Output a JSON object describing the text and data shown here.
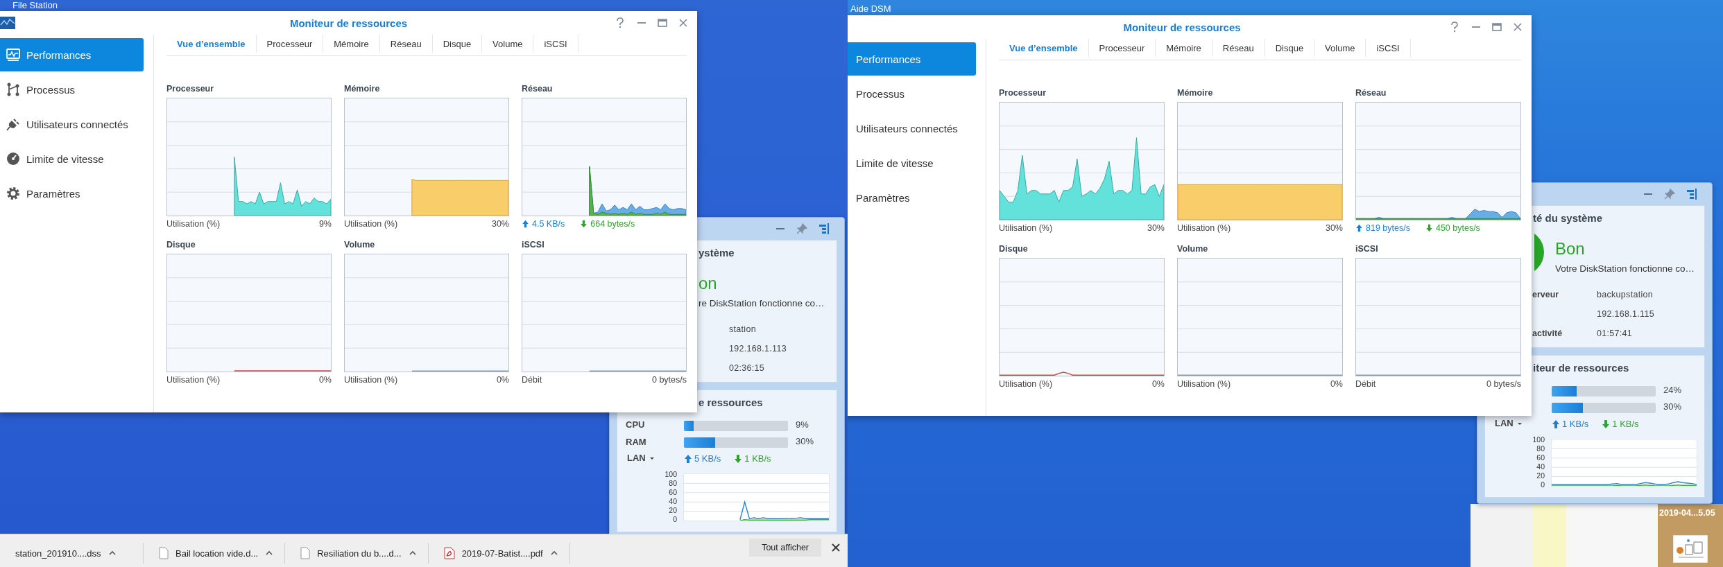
{
  "screens": [
    {
      "top_label": "File Station",
      "window": {
        "title": "Moniteur de ressources",
        "sidebar": [
          {
            "label": "Performances",
            "selected": true
          },
          {
            "label": "Processus",
            "selected": false
          },
          {
            "label": "Utilisateurs connectés",
            "selected": false
          },
          {
            "label": "Limite de vitesse",
            "selected": false
          },
          {
            "label": "Paramètres",
            "selected": false
          }
        ],
        "tabs": [
          {
            "label": "Vue d’ensemble",
            "selected": true
          },
          {
            "label": "Processeur",
            "selected": false
          },
          {
            "label": "Mémoire",
            "selected": false
          },
          {
            "label": "Réseau",
            "selected": false
          },
          {
            "label": "Disque",
            "selected": false
          },
          {
            "label": "Volume",
            "selected": false
          },
          {
            "label": "iSCSI",
            "selected": false
          }
        ],
        "panels": [
          {
            "kind": "usage",
            "title": "Processeur",
            "caption": "Utilisation (%)",
            "value": "9%"
          },
          {
            "kind": "usage",
            "title": "Mémoire",
            "caption": "Utilisation (%)",
            "value": "30%"
          },
          {
            "kind": "network",
            "title": "Réseau",
            "upload": "4.5 KB/s",
            "download": "664 bytes/s"
          },
          {
            "kind": "usage",
            "title": "Disque",
            "caption": "Utilisation (%)",
            "value": "0%"
          },
          {
            "kind": "usage",
            "title": "Volume",
            "caption": "Utilisation (%)",
            "value": "0%"
          },
          {
            "kind": "usage",
            "title": "iSCSI",
            "caption": "Débit",
            "value": "0 bytes/s"
          }
        ]
      },
      "widget": {
        "health": {
          "title": "ystème",
          "status": "on",
          "message": "re DiskStation fonctionne co…",
          "rows": [
            {
              "value": "station"
            },
            {
              "value": "192.168.1.113"
            },
            {
              "value": "02:36:15"
            }
          ]
        },
        "monitor": {
          "title": "e ressources",
          "meters": [
            {
              "label": "CPU",
              "level": 0.09,
              "reading": "9%"
            },
            {
              "label": "RAM",
              "level": 0.3,
              "reading": "30%"
            }
          ],
          "network": {
            "label": "LAN",
            "upload": "5 KB/s",
            "download": "1 KB/s"
          },
          "chart_data": {
            "type": "line",
            "grid": true,
            "ylim": [
              0,
              100
            ],
            "yticks": [
              0,
              20,
              40,
              60,
              80,
              100
            ],
            "series": [
              {
                "color": "#2a86c8",
                "values": [
                  null,
                  null,
                  null,
                  null,
                  null,
                  null,
                  null,
                  null,
                  null,
                  null,
                  null,
                  null,
                  2,
                  40,
                  4,
                  6,
                  4,
                  6,
                  4,
                  4,
                  4,
                  4,
                  5,
                  4,
                  5,
                  6,
                  4,
                  4,
                  4,
                  4,
                  4,
                  4
                ]
              },
              {
                "color": "#3fae3f",
                "values": [
                  null,
                  null,
                  null,
                  null,
                  null,
                  null,
                  null,
                  null,
                  null,
                  null,
                  null,
                  null,
                  0,
                  2,
                  1,
                  1,
                  1,
                  1,
                  1,
                  1,
                  1,
                  1,
                  1,
                  1,
                  1,
                  1,
                  1,
                  2,
                  2,
                  2,
                  2,
                  2
                ]
              }
            ]
          }
        }
      },
      "downloads": {
        "items": [
          {
            "kind": "file",
            "name": "station_201910....dss"
          },
          {
            "kind": "document",
            "name": "Bail location vide.d..."
          },
          {
            "kind": "document",
            "name": "Resiliation du b....d..."
          },
          {
            "kind": "pdf",
            "name": "2019-07-Batist....pdf"
          }
        ],
        "show_all": "Tout afficher"
      }
    },
    {
      "top_label": "Aide DSM",
      "window": {
        "title": "Moniteur de ressources",
        "sidebar": [
          {
            "label": "Performances",
            "selected": true
          },
          {
            "label": "Processus",
            "selected": false
          },
          {
            "label": "Utilisateurs connectés",
            "selected": false
          },
          {
            "label": "Limite de vitesse",
            "selected": false
          },
          {
            "label": "Paramètres",
            "selected": false
          }
        ],
        "tabs": [
          {
            "label": "Vue d’ensemble",
            "selected": true
          },
          {
            "label": "Processeur",
            "selected": false
          },
          {
            "label": "Mémoire",
            "selected": false
          },
          {
            "label": "Réseau",
            "selected": false
          },
          {
            "label": "Disque",
            "selected": false
          },
          {
            "label": "Volume",
            "selected": false
          },
          {
            "label": "iSCSI",
            "selected": false
          }
        ],
        "panels": [
          {
            "kind": "usage",
            "title": "Processeur",
            "caption": "Utilisation (%)",
            "value": "30%"
          },
          {
            "kind": "usage",
            "title": "Mémoire",
            "caption": "Utilisation (%)",
            "value": "30%"
          },
          {
            "kind": "network",
            "title": "Réseau",
            "upload": "819 bytes/s",
            "download": "450 bytes/s"
          },
          {
            "kind": "usage",
            "title": "Disque",
            "caption": "Utilisation (%)",
            "value": "0%"
          },
          {
            "kind": "usage",
            "title": "Volume",
            "caption": "Utilisation (%)",
            "value": "0%"
          },
          {
            "kind": "usage",
            "title": "iSCSI",
            "caption": "Débit",
            "value": "0 bytes/s"
          }
        ]
      },
      "widget": {
        "health": {
          "title": "té du système",
          "status": "Bon",
          "status_icon": true,
          "message": "Votre DiskStation fonctionne co…",
          "rows": [
            {
              "label": "erveur",
              "value": "backupstation"
            },
            {
              "value": "192.168.1.115"
            },
            {
              "label": "activité",
              "value": "01:57:41"
            }
          ]
        },
        "monitor": {
          "title": "iteur de ressources",
          "meters": [
            {
              "level": 0.24,
              "reading": "24%"
            },
            {
              "level": 0.3,
              "reading": "30%"
            }
          ],
          "network": {
            "label": "LAN",
            "upload": "1 KB/s",
            "download": "1 KB/s"
          },
          "chart_data": {
            "type": "line",
            "grid": true,
            "ylim": [
              0,
              100
            ],
            "yticks": [
              0,
              20,
              40,
              60,
              80,
              100
            ],
            "series": [
              {
                "color": "#2a86c8",
                "values": [
                  3,
                  3,
                  3,
                  3,
                  3,
                  3,
                  3,
                  3,
                  3,
                  3,
                  3,
                  3,
                  3,
                  4,
                  5,
                  3,
                  3,
                  3,
                  3,
                  5,
                  7,
                  6,
                  4,
                  3,
                  3,
                  4,
                  7,
                  9,
                  7,
                  6,
                  5,
                  3
                ]
              },
              {
                "color": "#3fae3f",
                "values": [
                  0,
                  0,
                  0,
                  0,
                  0,
                  0,
                  0,
                  0,
                  0,
                  0,
                  0,
                  0,
                  0,
                  0,
                  1,
                  0,
                  0,
                  0,
                  0,
                  1,
                  2,
                  1,
                  0,
                  0,
                  0,
                  0,
                  1,
                  2,
                  1,
                  1,
                  1,
                  0
                ]
              }
            ]
          }
        }
      },
      "desktop_file": {
        "name": "2019-04...5.05"
      }
    }
  ]
}
